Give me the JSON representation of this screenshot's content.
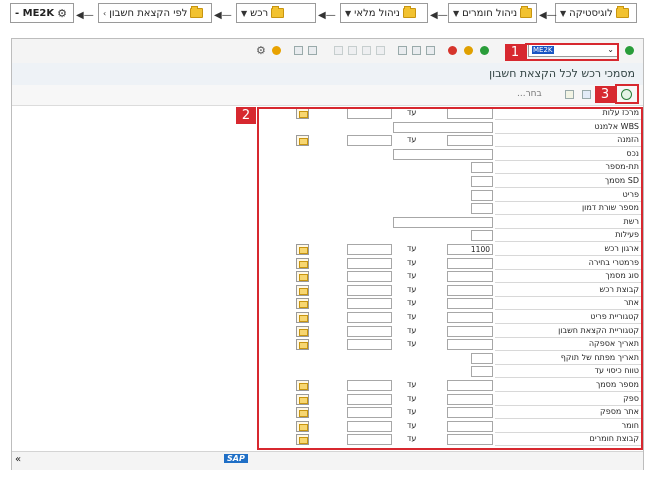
{
  "breadcrumb": {
    "items": [
      "לוגיסטיקה",
      "ניהול חומרים",
      "ניהול מלאי",
      "רכש",
      "לפי הקצאת חשבון"
    ],
    "tcode": "ME2K -"
  },
  "toolbar": {
    "command_value": "ME2K"
  },
  "screen_title": "מסמכי רכש לכל הקצאת חשבון",
  "app_toolbar": {
    "more_label": "...בחר"
  },
  "annotations": [
    "1",
    "2",
    "3"
  ],
  "form": {
    "to_label": "עד",
    "rows": [
      {
        "label": "מרכז עלות",
        "value": "",
        "range": true
      },
      {
        "label": "אלמנט WBS",
        "value": "",
        "range": false
      },
      {
        "label": "הזמנה",
        "value": "",
        "range": true
      },
      {
        "label": "נכס",
        "value": "",
        "range": false
      },
      {
        "label": "תת-מספר",
        "value": "",
        "range": false
      },
      {
        "label": "מסמך SD",
        "value": "",
        "range": false
      },
      {
        "label": "פריט",
        "value": "",
        "range": false
      },
      {
        "label": "מספר שורת דמון",
        "value": "",
        "range": false
      },
      {
        "label": "רשת",
        "value": "",
        "range": false
      },
      {
        "label": "פעילות",
        "value": "",
        "range": false
      },
      {
        "label": "ארגון רכש",
        "value": "1100",
        "range": true
      },
      {
        "label": "פרמטרי בחירה",
        "value": "",
        "range": true
      },
      {
        "label": "סוג מסמך",
        "value": "",
        "range": true
      },
      {
        "label": "קבוצת רכש",
        "value": "",
        "range": true
      },
      {
        "label": "אתר",
        "value": "",
        "range": true
      },
      {
        "label": "קטגוריית פריט",
        "value": "",
        "range": true
      },
      {
        "label": "קטגוריית הקצאת חשבון",
        "value": "",
        "range": true
      },
      {
        "label": "תאריך אספקה",
        "value": "",
        "range": true
      },
      {
        "label": "תאריך מפתח של תוקף",
        "value": "",
        "range": false
      },
      {
        "label": "טווח כיסוי עד",
        "value": "",
        "range": false
      },
      {
        "label": "מספר מסמך",
        "value": "",
        "range": true
      },
      {
        "label": "ספק",
        "value": "",
        "range": true
      },
      {
        "label": "אתר מספק",
        "value": "",
        "range": true
      },
      {
        "label": "חומר",
        "value": "",
        "range": true
      },
      {
        "label": "קבוצת חומרים",
        "value": "",
        "range": true
      }
    ]
  },
  "status_bar": {
    "left": "«",
    "logo": "SAP"
  },
  "colors": {
    "annotation": "#d7282f",
    "folder": "#f2c230",
    "accept_green": "#2a9d3a",
    "cancel_red": "#d6352c"
  }
}
